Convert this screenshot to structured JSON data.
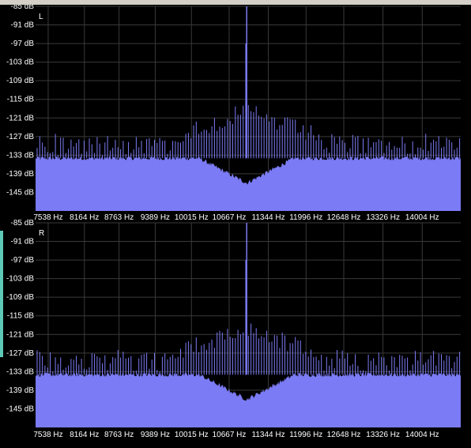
{
  "chart_data": [
    {
      "type": "bar",
      "channel_label": "L",
      "y_unit": "dB",
      "y_ticks": [
        "-85 dB",
        "-91 dB",
        "-97 dB",
        "-103 dB",
        "-109 dB",
        "-115 dB",
        "-121 dB",
        "-127 dB",
        "-133 dB",
        "-139 dB",
        "-145 dB"
      ],
      "y_values": [
        -85,
        -91,
        -97,
        -103,
        -109,
        -115,
        -121,
        -127,
        -133,
        -139,
        -145
      ],
      "ylim": [
        -151,
        -85
      ],
      "x_ticks": [
        "7538 Hz",
        "8164 Hz",
        "8763 Hz",
        "9389 Hz",
        "10015 Hz",
        "10667 Hz",
        "11344 Hz",
        "11996 Hz",
        "12648 Hz",
        "13326 Hz",
        "14004 Hz"
      ],
      "x_values": [
        7538,
        8164,
        8763,
        9389,
        10015,
        10667,
        11344,
        11996,
        12648,
        13326,
        14004
      ],
      "xlim": [
        7320,
        14670
      ],
      "noise_floor_db": -134,
      "peak": {
        "x": 10970,
        "y": -85
      },
      "grid": true,
      "fill_color": "#7b7bf5",
      "background_color": "#000000",
      "grid_color": "#3a3a3a"
    },
    {
      "type": "bar",
      "channel_label": "R",
      "y_unit": "dB",
      "y_ticks": [
        "-85 dB",
        "-91 dB",
        "-97 dB",
        "-103 dB",
        "-109 dB",
        "-115 dB",
        "-121 dB",
        "-127 dB",
        "-133 dB",
        "-139 dB",
        "-145 dB"
      ],
      "y_values": [
        -85,
        -91,
        -97,
        -103,
        -109,
        -115,
        -121,
        -127,
        -133,
        -139,
        -145
      ],
      "ylim": [
        -151,
        -85
      ],
      "x_ticks": [
        "7538 Hz",
        "8164 Hz",
        "8763 Hz",
        "9389 Hz",
        "10015 Hz",
        "10667 Hz",
        "11344 Hz",
        "11996 Hz",
        "12648 Hz",
        "13326 Hz",
        "14004 Hz"
      ],
      "x_values": [
        7538,
        8164,
        8763,
        9389,
        10015,
        10667,
        11344,
        11996,
        12648,
        13326,
        14004
      ],
      "xlim": [
        7320,
        14670
      ],
      "noise_floor_db": -134,
      "peak": {
        "x": 10970,
        "y": -85
      },
      "grid": true,
      "fill_color": "#7b7bf5",
      "background_color": "#000000",
      "grid_color": "#3a3a3a"
    }
  ]
}
